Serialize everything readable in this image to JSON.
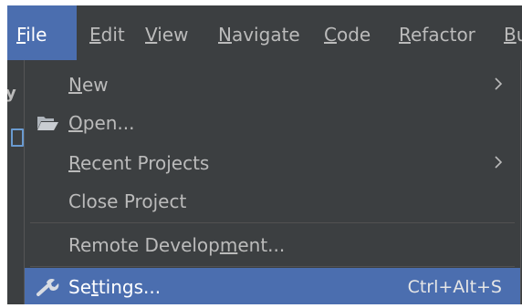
{
  "menubar": {
    "items": [
      {
        "pre": "",
        "mn": "F",
        "post": "ile"
      },
      {
        "pre": "",
        "mn": "E",
        "post": "dit"
      },
      {
        "pre": "",
        "mn": "V",
        "post": "iew"
      },
      {
        "pre": "",
        "mn": "N",
        "post": "avigate"
      },
      {
        "pre": "",
        "mn": "C",
        "post": "ode"
      },
      {
        "pre": "",
        "mn": "R",
        "post": "efactor"
      },
      {
        "pre": "",
        "mn": "B",
        "post": "u"
      }
    ]
  },
  "left_strip": {
    "text": "y"
  },
  "file_menu": {
    "new": {
      "pre": "",
      "mn": "N",
      "post": "ew"
    },
    "open": {
      "pre": "",
      "mn": "O",
      "post": "pen..."
    },
    "recent_projects": {
      "pre": "",
      "mn": "R",
      "post": "ecent Projects"
    },
    "close_project": {
      "pre": "Close Pro",
      "mn": "j",
      "post": "ect"
    },
    "remote_development": {
      "pre": "Remote Develop",
      "mn": "m",
      "post": "ent..."
    },
    "settings": {
      "pre": "Se",
      "mn": "t",
      "post": "tings...",
      "shortcut": "Ctrl+Alt+S"
    }
  },
  "icons": {
    "open": "folder-open-icon",
    "settings": "wrench-icon",
    "submenu": "chevron-right-icon"
  },
  "colors": {
    "menu_background": "#3c3f41",
    "selection": "#4b6eaf",
    "text": "#bbbbbb",
    "text_selected": "#ffffff"
  }
}
